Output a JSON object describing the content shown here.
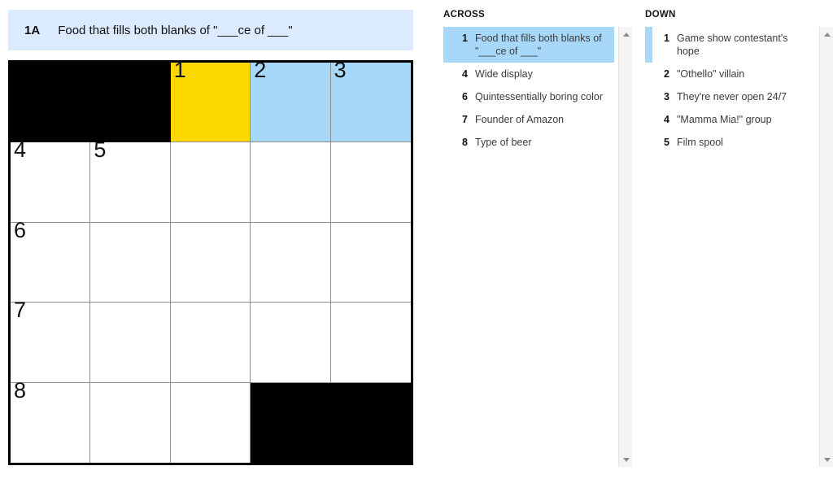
{
  "banner": {
    "number": "1A",
    "text": "Food that fills both blanks of \"___ce of ___\""
  },
  "colors": {
    "active_cell": "#fdd700",
    "word_highlight": "#a7d8f9",
    "banner_bg": "#dbeafc",
    "block": "#000000"
  },
  "grid": {
    "rows": 5,
    "cols": 5,
    "cells": [
      {
        "state": "block",
        "number": "",
        "letter": ""
      },
      {
        "state": "block",
        "number": "",
        "letter": ""
      },
      {
        "state": "active",
        "number": "1",
        "letter": ""
      },
      {
        "state": "inword",
        "number": "2",
        "letter": ""
      },
      {
        "state": "inword",
        "number": "3",
        "letter": ""
      },
      {
        "state": "open",
        "number": "4",
        "letter": ""
      },
      {
        "state": "open",
        "number": "5",
        "letter": ""
      },
      {
        "state": "open",
        "number": "",
        "letter": ""
      },
      {
        "state": "open",
        "number": "",
        "letter": ""
      },
      {
        "state": "open",
        "number": "",
        "letter": ""
      },
      {
        "state": "open",
        "number": "6",
        "letter": ""
      },
      {
        "state": "open",
        "number": "",
        "letter": ""
      },
      {
        "state": "open",
        "number": "",
        "letter": ""
      },
      {
        "state": "open",
        "number": "",
        "letter": ""
      },
      {
        "state": "open",
        "number": "",
        "letter": ""
      },
      {
        "state": "open",
        "number": "7",
        "letter": ""
      },
      {
        "state": "open",
        "number": "",
        "letter": ""
      },
      {
        "state": "open",
        "number": "",
        "letter": ""
      },
      {
        "state": "open",
        "number": "",
        "letter": ""
      },
      {
        "state": "open",
        "number": "",
        "letter": ""
      },
      {
        "state": "open",
        "number": "8",
        "letter": ""
      },
      {
        "state": "open",
        "number": "",
        "letter": ""
      },
      {
        "state": "open",
        "number": "",
        "letter": ""
      },
      {
        "state": "block",
        "number": "",
        "letter": ""
      },
      {
        "state": "block",
        "number": "",
        "letter": ""
      }
    ]
  },
  "across": {
    "title": "ACROSS",
    "clues": [
      {
        "number": "1",
        "text": "Food that fills both blanks of \"___ce of ___\"",
        "state": "selected"
      },
      {
        "number": "4",
        "text": "Wide display",
        "state": "normal"
      },
      {
        "number": "6",
        "text": "Quintessentially boring color",
        "state": "normal"
      },
      {
        "number": "7",
        "text": "Founder of Amazon",
        "state": "normal"
      },
      {
        "number": "8",
        "text": "Type of beer",
        "state": "normal"
      }
    ]
  },
  "down": {
    "title": "DOWN",
    "clues": [
      {
        "number": "1",
        "text": "Game show contestant's hope",
        "state": "marked"
      },
      {
        "number": "2",
        "text": "\"Othello\" villain",
        "state": "normal"
      },
      {
        "number": "3",
        "text": "They're never open 24/7",
        "state": "normal"
      },
      {
        "number": "4",
        "text": "\"Mamma Mia!\" group",
        "state": "normal"
      },
      {
        "number": "5",
        "text": "Film spool",
        "state": "normal"
      }
    ]
  },
  "scrollbars": {
    "up_arrow_icon": "chevron-up-icon",
    "down_arrow_icon": "chevron-down-icon"
  }
}
